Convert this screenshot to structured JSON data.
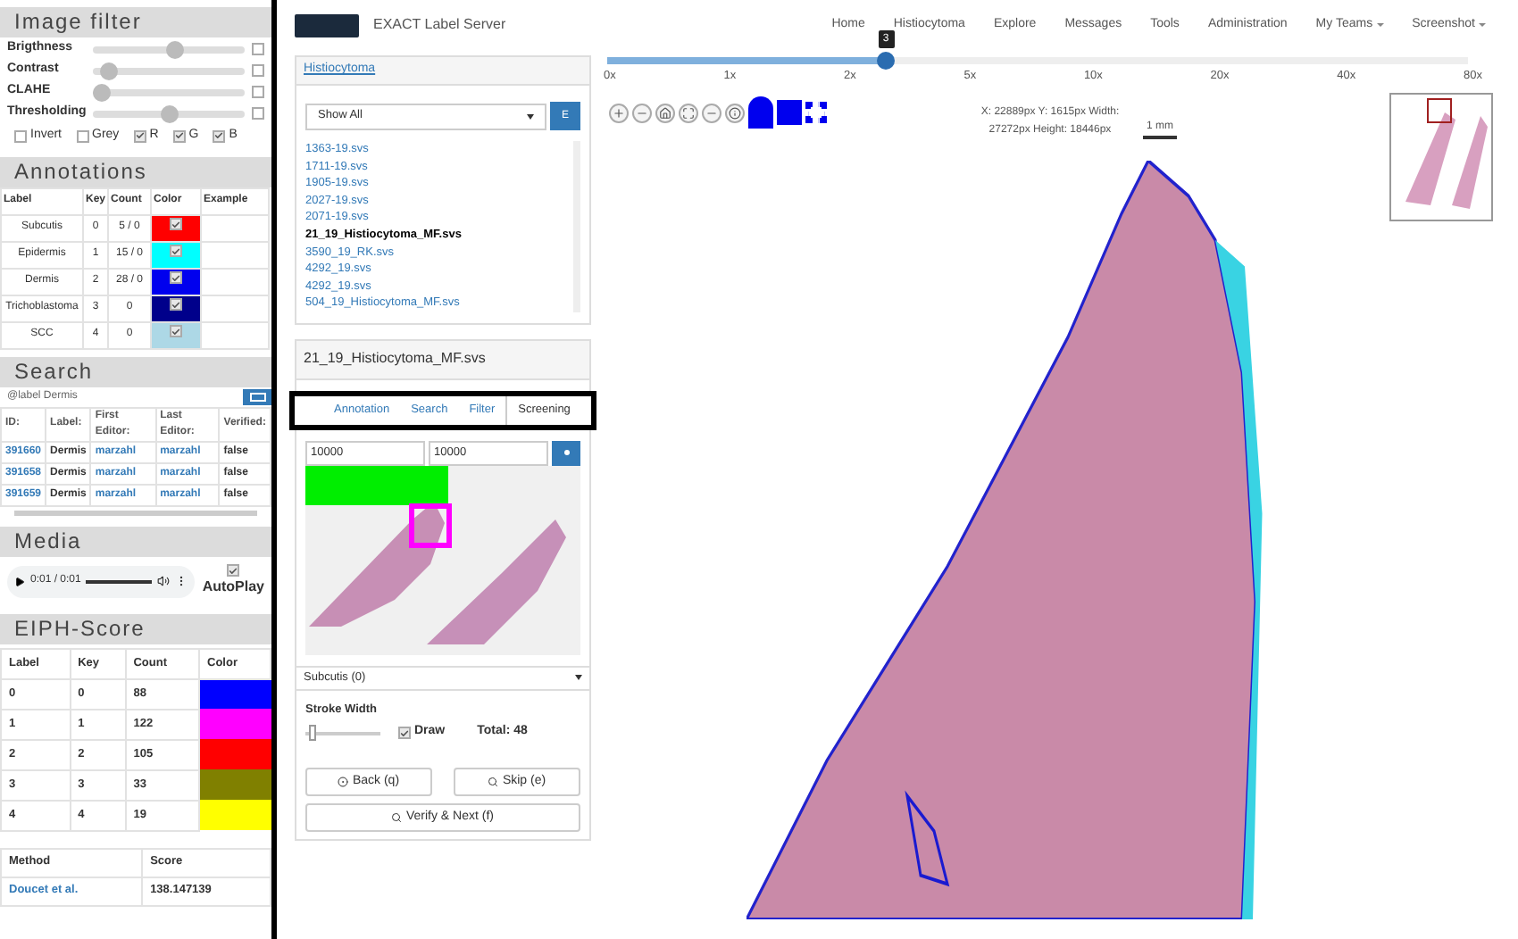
{
  "image_filter": {
    "title": "Image filter",
    "sliders": [
      {
        "label": "Brigthness",
        "level": 0.55,
        "checked": false
      },
      {
        "label": "Contrast",
        "level": 0.05,
        "checked": false
      },
      {
        "label": "CLAHE",
        "level": 0.0,
        "checked": false
      },
      {
        "label": "Thresholding",
        "level": 0.5,
        "checked": false
      }
    ],
    "channels": [
      {
        "label": "Invert",
        "checked": false
      },
      {
        "label": "Grey",
        "checked": false
      },
      {
        "label": "R",
        "checked": true
      },
      {
        "label": "G",
        "checked": true
      },
      {
        "label": "B",
        "checked": true
      }
    ]
  },
  "annotations": {
    "title": "Annotations",
    "columns": [
      "Label",
      "Key",
      "Count",
      "Color",
      "Example"
    ],
    "rows": [
      {
        "label": "Subcutis",
        "key": "0",
        "count": "5 / 0",
        "color": "#ff0000",
        "checked": true
      },
      {
        "label": "Epidermis",
        "key": "1",
        "count": "15 / 0",
        "color": "#00ffff",
        "checked": true
      },
      {
        "label": "Dermis",
        "key": "2",
        "count": "28 / 0",
        "color": "#0000ee",
        "checked": true
      },
      {
        "label": "Trichoblastoma",
        "key": "3",
        "count": "0",
        "color": "#00008b",
        "checked": true
      },
      {
        "label": "SCC",
        "key": "4",
        "count": "0",
        "color": "#add8e6",
        "checked": true
      }
    ]
  },
  "search": {
    "title": "Search",
    "query": "@label Dermis",
    "columns": [
      "ID:",
      "Label:",
      "First Editor:",
      "Last Editor:",
      "Verified:"
    ],
    "rows": [
      {
        "id": "391660",
        "label": "Dermis",
        "first_editor": "marzahl",
        "last_editor": "marzahl",
        "verified": "false"
      },
      {
        "id": "391658",
        "label": "Dermis",
        "first_editor": "marzahl",
        "last_editor": "marzahl",
        "verified": "false"
      },
      {
        "id": "391659",
        "label": "Dermis",
        "first_editor": "marzahl",
        "last_editor": "marzahl",
        "verified": "false"
      }
    ]
  },
  "media": {
    "title": "Media",
    "time": "0:01 / 0:01",
    "level": 1,
    "autoplay": {
      "label": "AutoPlay",
      "checked": true
    }
  },
  "eiph": {
    "title": "EIPH-Score",
    "columns": [
      "Label",
      "Key",
      "Count",
      "Color"
    ],
    "rows": [
      {
        "label": "0",
        "key": "0",
        "count": "88",
        "color": "#0000ff"
      },
      {
        "label": "1",
        "key": "1",
        "count": "122",
        "color": "#ff00ff"
      },
      {
        "label": "2",
        "key": "2",
        "count": "105",
        "color": "#ff0000"
      },
      {
        "label": "3",
        "key": "3",
        "count": "33",
        "color": "#808000"
      },
      {
        "label": "4",
        "key": "4",
        "count": "19",
        "color": "#ffff00"
      }
    ],
    "score_columns": [
      "Method",
      "Score"
    ],
    "score_rows": [
      {
        "method": "Doucet et al.",
        "score": "138.147139"
      }
    ]
  },
  "nav": {
    "brand": "EXACT Label Server",
    "items": [
      {
        "label": "Home",
        "dropdown": false
      },
      {
        "label": "Histiocytoma",
        "dropdown": false
      },
      {
        "label": "Explore",
        "dropdown": false
      },
      {
        "label": "Messages",
        "dropdown": false
      },
      {
        "label": "Tools",
        "dropdown": false
      },
      {
        "label": "Administration",
        "dropdown": false
      },
      {
        "label": "My Teams",
        "dropdown": true
      },
      {
        "label": "Screenshot",
        "dropdown": true
      }
    ]
  },
  "images": {
    "project": "Histiocytoma",
    "filter": "Show All",
    "filter_button": "E",
    "files": [
      {
        "name": "1363-19.svs",
        "selected": false
      },
      {
        "name": "1711-19.svs",
        "selected": false
      },
      {
        "name": "1905-19.svs",
        "selected": false
      },
      {
        "name": "2027-19.svs",
        "selected": false
      },
      {
        "name": "2071-19.svs",
        "selected": false
      },
      {
        "name": "21_19_Histiocytoma_MF.svs",
        "selected": true
      },
      {
        "name": "3590_19_RK.svs",
        "selected": false
      },
      {
        "name": "4292_19.svs",
        "selected": false
      },
      {
        "name": "4292_19.svs",
        "selected": false
      },
      {
        "name": "504_19_Histiocytoma_MF.svs",
        "selected": false
      }
    ]
  },
  "tool_panel": {
    "image_title": "21_19_Histiocytoma_MF.svs",
    "tabs": [
      {
        "label": "Annotation",
        "selected": false
      },
      {
        "label": "Search",
        "selected": false
      },
      {
        "label": "Filter",
        "selected": false
      },
      {
        "label": "Screening",
        "selected": true
      }
    ],
    "x_field": "10000",
    "y_field": "10000",
    "annotation_type": "Subcutis (0)",
    "stroke_label": "Stroke Width",
    "stroke": {
      "level": 0.05
    },
    "draw": {
      "label": "Draw",
      "checked": true
    },
    "total": "Total: 48",
    "buttons": [
      "Back (q)",
      "Skip (e)",
      "Verify & Next (f)"
    ]
  },
  "viewer": {
    "zoom_ticks": [
      "0x",
      "1x",
      "2x",
      "5x",
      "10x",
      "20x",
      "40x",
      "80x"
    ],
    "zoom": {
      "level": 0.32
    },
    "zoom_tooltip": "3",
    "coordinates": "X: 22889px Y: 1615px Width: 27272px Height: 18446px",
    "scale": "1 mm"
  }
}
